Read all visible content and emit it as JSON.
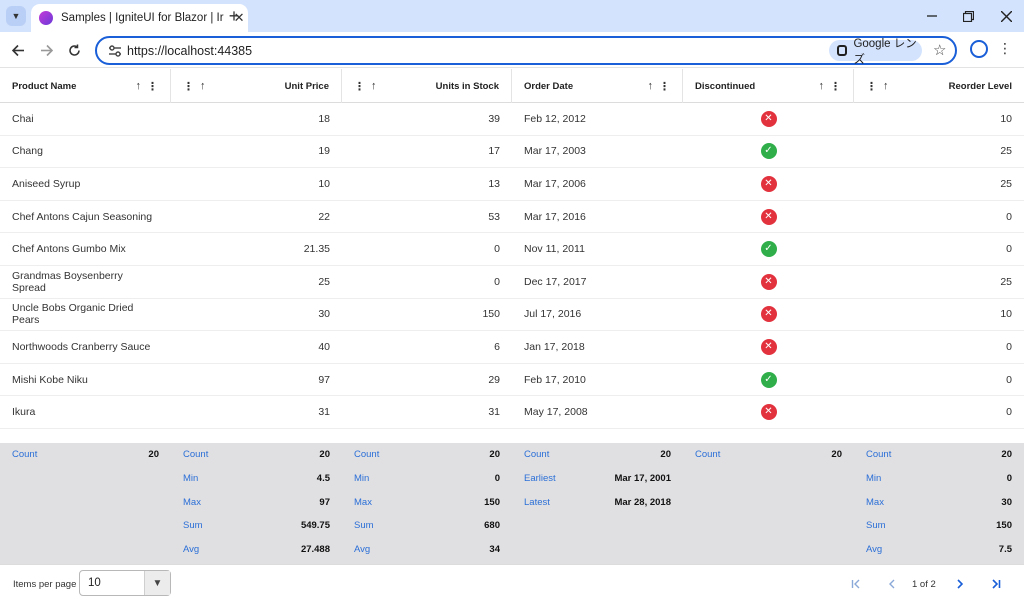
{
  "browser": {
    "tab_title": "Samples | IgniteUI for Blazor | Ir",
    "url": "https://localhost:44385",
    "lens_label": "Google レンズ"
  },
  "grid": {
    "columns": [
      {
        "key": "name",
        "label": "Product Name"
      },
      {
        "key": "price",
        "label": "Unit Price"
      },
      {
        "key": "stock",
        "label": "Units in Stock"
      },
      {
        "key": "date",
        "label": "Order Date"
      },
      {
        "key": "discontinued",
        "label": "Discontinued"
      },
      {
        "key": "reorder",
        "label": "Reorder Level"
      }
    ],
    "rows": [
      {
        "name": "Chai",
        "price": "18",
        "stock": "39",
        "date": "Feb 12, 2012",
        "discontinued": false,
        "reorder": "10"
      },
      {
        "name": "Chang",
        "price": "19",
        "stock": "17",
        "date": "Mar 17, 2003",
        "discontinued": true,
        "reorder": "25"
      },
      {
        "name": "Aniseed Syrup",
        "price": "10",
        "stock": "13",
        "date": "Mar 17, 2006",
        "discontinued": false,
        "reorder": "25"
      },
      {
        "name": "Chef Antons Cajun Seasoning",
        "price": "22",
        "stock": "53",
        "date": "Mar 17, 2016",
        "discontinued": false,
        "reorder": "0"
      },
      {
        "name": "Chef Antons Gumbo Mix",
        "price": "21.35",
        "stock": "0",
        "date": "Nov 11, 2011",
        "discontinued": true,
        "reorder": "0"
      },
      {
        "name": "Grandmas Boysenberry Spread",
        "price": "25",
        "stock": "0",
        "date": "Dec 17, 2017",
        "discontinued": false,
        "reorder": "25"
      },
      {
        "name": "Uncle Bobs Organic Dried Pears",
        "price": "30",
        "stock": "150",
        "date": "Jul 17, 2016",
        "discontinued": false,
        "reorder": "10"
      },
      {
        "name": "Northwoods Cranberry Sauce",
        "price": "40",
        "stock": "6",
        "date": "Jan 17, 2018",
        "discontinued": false,
        "reorder": "0"
      },
      {
        "name": "Mishi Kobe Niku",
        "price": "97",
        "stock": "29",
        "date": "Feb 17, 2010",
        "discontinued": true,
        "reorder": "0"
      },
      {
        "name": "Ikura",
        "price": "31",
        "stock": "31",
        "date": "May 17, 2008",
        "discontinued": false,
        "reorder": "0"
      }
    ],
    "summaries": [
      [
        {
          "label": "Count",
          "value": "20"
        }
      ],
      [
        {
          "label": "Count",
          "value": "20"
        },
        {
          "label": "Min",
          "value": "4.5"
        },
        {
          "label": "Max",
          "value": "97"
        },
        {
          "label": "Sum",
          "value": "549.75"
        },
        {
          "label": "Avg",
          "value": "27.488"
        }
      ],
      [
        {
          "label": "Count",
          "value": "20"
        },
        {
          "label": "Min",
          "value": "0"
        },
        {
          "label": "Max",
          "value": "150"
        },
        {
          "label": "Sum",
          "value": "680"
        },
        {
          "label": "Avg",
          "value": "34"
        }
      ],
      [
        {
          "label": "Count",
          "value": "20"
        },
        {
          "label": "Earliest",
          "value": "Mar 17, 2001"
        },
        {
          "label": "Latest",
          "value": "Mar 28, 2018"
        }
      ],
      [
        {
          "label": "Count",
          "value": "20"
        }
      ],
      [
        {
          "label": "Count",
          "value": "20"
        },
        {
          "label": "Min",
          "value": "0"
        },
        {
          "label": "Max",
          "value": "30"
        },
        {
          "label": "Sum",
          "value": "150"
        },
        {
          "label": "Avg",
          "value": "7.5"
        }
      ]
    ]
  },
  "pager": {
    "items_per_page_label": "Items per page",
    "items_per_page_value": "10",
    "page_text": "1 of 2"
  },
  "colors": {
    "accent": "#2b6fd6",
    "discontinued_no": "#e2323e",
    "discontinued_yes": "#2fae4a",
    "summary_bg": "#e0e0e3"
  }
}
